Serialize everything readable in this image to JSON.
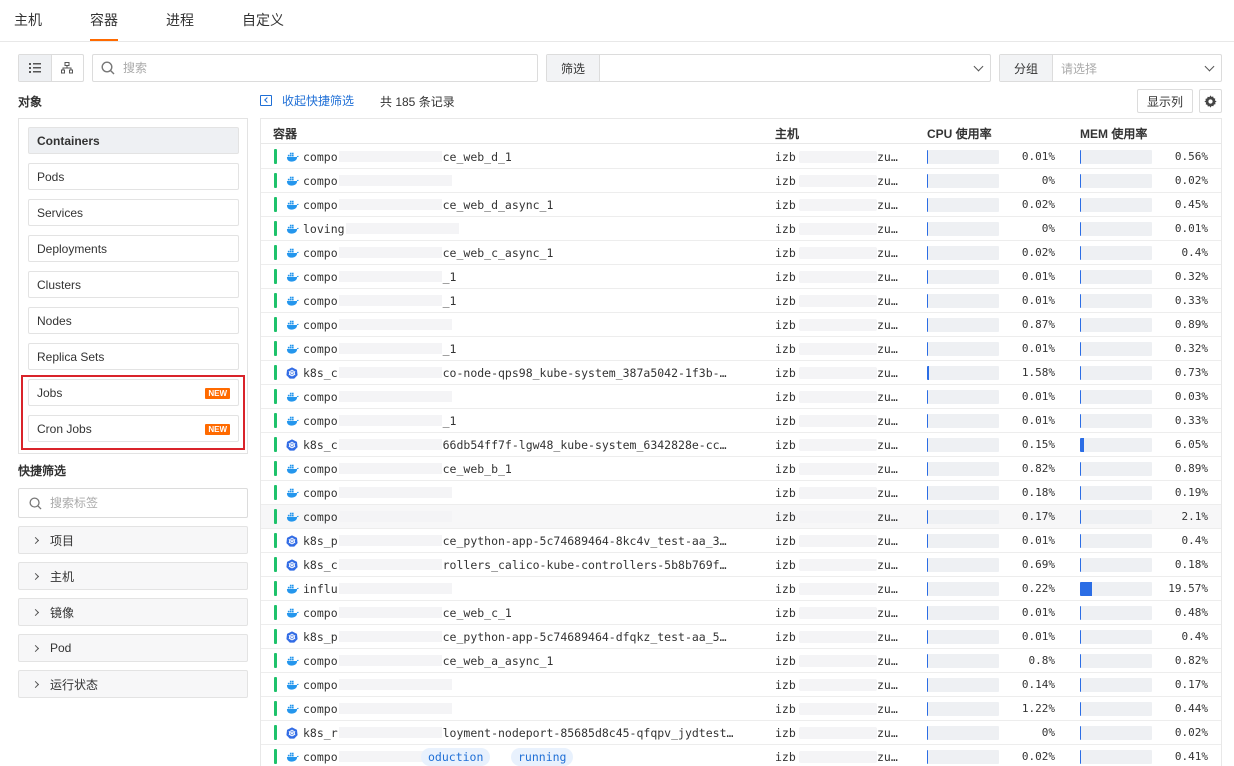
{
  "top_tabs": [
    "主机",
    "容器",
    "进程",
    "自定义"
  ],
  "active_tab": "容器",
  "toolbar": {
    "search_placeholder": "搜索",
    "filter_label": "筛选",
    "group_label": "分组",
    "group_placeholder": "请选择"
  },
  "objects": {
    "title": "对象",
    "items": [
      {
        "label": "Containers",
        "active": true
      },
      {
        "label": "Pods"
      },
      {
        "label": "Services"
      },
      {
        "label": "Deployments"
      },
      {
        "label": "Clusters"
      },
      {
        "label": "Nodes"
      },
      {
        "label": "Replica Sets"
      },
      {
        "label": "Jobs",
        "badge": "NEW"
      },
      {
        "label": "Cron Jobs",
        "badge": "NEW"
      }
    ]
  },
  "quick_filter": {
    "title": "快捷筛选",
    "tag_search_placeholder": "搜索标签",
    "facets": [
      "项目",
      "主机",
      "镜像",
      "Pod",
      "运行状态"
    ]
  },
  "list": {
    "collapse_label": "收起快捷筛选",
    "record_count": "共 185 条记录",
    "columns_button": "显示列",
    "headers": {
      "container": "容器",
      "host": "主机",
      "cpu": "CPU 使用率",
      "mem": "MEM 使用率"
    },
    "host_prefix": "izb",
    "host_suffix": "zu…",
    "rows": [
      {
        "type": "docker",
        "prefix": "compo",
        "suffix": "ce_web_d_1",
        "cpu": "0.01%",
        "cpu_frac": 0.01,
        "mem": "0.56%",
        "mem_frac": 0.56
      },
      {
        "type": "docker",
        "prefix": "compo",
        "suffix": "",
        "cpu": "0%",
        "cpu_frac": 0,
        "mem": "0.02%",
        "mem_frac": 0.02
      },
      {
        "type": "docker",
        "prefix": "compo",
        "suffix": "ce_web_d_async_1",
        "cpu": "0.02%",
        "cpu_frac": 0.02,
        "mem": "0.45%",
        "mem_frac": 0.45
      },
      {
        "type": "docker",
        "prefix": "loving",
        "suffix": "",
        "cpu": "0%",
        "cpu_frac": 0,
        "mem": "0.01%",
        "mem_frac": 0.01
      },
      {
        "type": "docker",
        "prefix": "compo",
        "suffix": "ce_web_c_async_1",
        "cpu": "0.02%",
        "cpu_frac": 0.02,
        "mem": "0.4%",
        "mem_frac": 0.4
      },
      {
        "type": "docker",
        "prefix": "compo",
        "suffix": "_1",
        "cpu": "0.01%",
        "cpu_frac": 0.01,
        "mem": "0.32%",
        "mem_frac": 0.32
      },
      {
        "type": "docker",
        "prefix": "compo",
        "suffix": "_1",
        "cpu": "0.01%",
        "cpu_frac": 0.01,
        "mem": "0.33%",
        "mem_frac": 0.33
      },
      {
        "type": "docker",
        "prefix": "compo",
        "suffix": "",
        "cpu": "0.87%",
        "cpu_frac": 0.87,
        "mem": "0.89%",
        "mem_frac": 0.89
      },
      {
        "type": "docker",
        "prefix": "compo",
        "suffix": "_1",
        "cpu": "0.01%",
        "cpu_frac": 0.01,
        "mem": "0.32%",
        "mem_frac": 0.32
      },
      {
        "type": "k8s",
        "prefix": "k8s_c",
        "suffix": "co-node-qps98_kube-system_387a5042-1f3b-…",
        "cpu": "1.58%",
        "cpu_frac": 1.58,
        "mem": "0.73%",
        "mem_frac": 0.73
      },
      {
        "type": "docker",
        "prefix": "compo",
        "suffix": "",
        "cpu": "0.01%",
        "cpu_frac": 0.01,
        "mem": "0.03%",
        "mem_frac": 0.03
      },
      {
        "type": "docker",
        "prefix": "compo",
        "suffix": "_1",
        "cpu": "0.01%",
        "cpu_frac": 0.01,
        "mem": "0.33%",
        "mem_frac": 0.33
      },
      {
        "type": "k8s",
        "prefix": "k8s_c",
        "suffix": "66db54ff7f-lgw48_kube-system_6342828e-cc…",
        "cpu": "0.15%",
        "cpu_frac": 0.15,
        "mem": "6.05%",
        "mem_frac": 6.05
      },
      {
        "type": "docker",
        "prefix": "compo",
        "suffix": "ce_web_b_1",
        "cpu": "0.82%",
        "cpu_frac": 0.82,
        "mem": "0.89%",
        "mem_frac": 0.89
      },
      {
        "type": "docker",
        "prefix": "compo",
        "suffix": "",
        "cpu": "0.18%",
        "cpu_frac": 0.18,
        "mem": "0.19%",
        "mem_frac": 0.19
      },
      {
        "type": "docker",
        "prefix": "compo",
        "suffix": "",
        "cpu": "0.17%",
        "cpu_frac": 0.17,
        "mem": "2.1%",
        "mem_frac": 2.1,
        "highlight": true
      },
      {
        "type": "k8s",
        "prefix": "k8s_p",
        "suffix": "ce_python-app-5c74689464-8kc4v_test-aa_3…",
        "cpu": "0.01%",
        "cpu_frac": 0.01,
        "mem": "0.4%",
        "mem_frac": 0.4
      },
      {
        "type": "k8s",
        "prefix": "k8s_c",
        "suffix": "rollers_calico-kube-controllers-5b8b769f…",
        "cpu": "0.69%",
        "cpu_frac": 0.69,
        "mem": "0.18%",
        "mem_frac": 0.18
      },
      {
        "type": "docker",
        "prefix": "influ",
        "suffix": "",
        "cpu": "0.22%",
        "cpu_frac": 0.22,
        "mem": "19.57%",
        "mem_frac": 19.57
      },
      {
        "type": "docker",
        "prefix": "compo",
        "suffix": "ce_web_c_1",
        "cpu": "0.01%",
        "cpu_frac": 0.01,
        "mem": "0.48%",
        "mem_frac": 0.48
      },
      {
        "type": "k8s",
        "prefix": "k8s_p",
        "suffix": "ce_python-app-5c74689464-dfqkz_test-aa_5…",
        "cpu": "0.01%",
        "cpu_frac": 0.01,
        "mem": "0.4%",
        "mem_frac": 0.4
      },
      {
        "type": "docker",
        "prefix": "compo",
        "suffix": "ce_web_a_async_1",
        "cpu": "0.8%",
        "cpu_frac": 0.8,
        "mem": "0.82%",
        "mem_frac": 0.82
      },
      {
        "type": "docker",
        "prefix": "compo",
        "suffix": "",
        "cpu": "0.14%",
        "cpu_frac": 0.14,
        "mem": "0.17%",
        "mem_frac": 0.17
      },
      {
        "type": "docker",
        "prefix": "compo",
        "suffix": "",
        "cpu": "1.22%",
        "cpu_frac": 1.22,
        "mem": "0.44%",
        "mem_frac": 0.44
      },
      {
        "type": "k8s",
        "prefix": "k8s_r",
        "suffix": "loyment-nodeport-85685d8c45-qfqpv_jydtest…",
        "cpu": "0%",
        "cpu_frac": 0,
        "mem": "0.02%",
        "mem_frac": 0.02
      },
      {
        "type": "docker",
        "prefix": "compo",
        "suffix": "",
        "cpu": "0.02%",
        "cpu_frac": 0.02,
        "mem": "0.41%",
        "mem_frac": 0.41,
        "pills": [
          "oduction",
          "running"
        ]
      }
    ]
  },
  "colors": {
    "accent": "#ff6a00",
    "link": "#1f6fd6",
    "status_ok": "#1ec26b",
    "bar": "#2b6de5",
    "highlight_box": "#d9232a"
  }
}
